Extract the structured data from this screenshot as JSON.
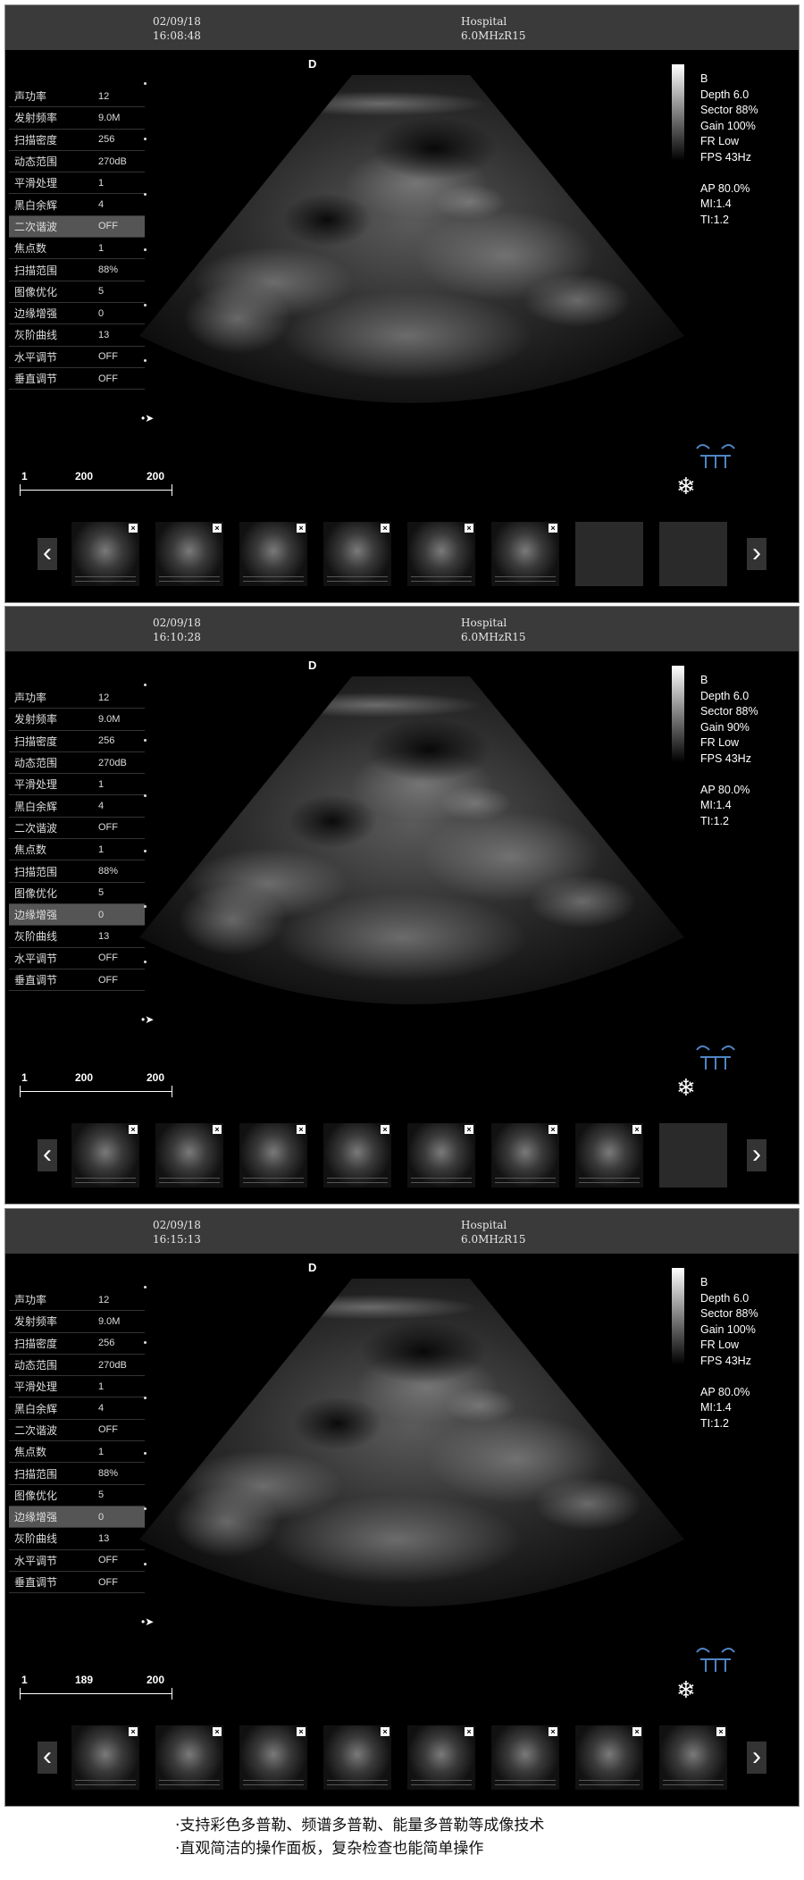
{
  "colors": {
    "background": "#000000",
    "header": "#3a3a3a",
    "probe_icon": "#4f84c4",
    "active_row": "#555555"
  },
  "panels": [
    {
      "date": "02/09/18",
      "time": "16:08:48",
      "hospital": "Hospital",
      "probe": "6.0MHzR15",
      "depth_marker": "D",
      "params": [
        {
          "label": "声功率",
          "value": "12"
        },
        {
          "label": "发射频率",
          "value": "9.0M"
        },
        {
          "label": "扫描密度",
          "value": "256"
        },
        {
          "label": "动态范围",
          "value": "270dB"
        },
        {
          "label": "平滑处理",
          "value": "1"
        },
        {
          "label": "黑白余辉",
          "value": "4"
        },
        {
          "label": "二次谐波",
          "value": "OFF"
        },
        {
          "label": "焦点数",
          "value": "1"
        },
        {
          "label": "扫描范围",
          "value": "88%"
        },
        {
          "label": "图像优化",
          "value": "5"
        },
        {
          "label": "边缘增强",
          "value": "0"
        },
        {
          "label": "灰阶曲线",
          "value": "13"
        },
        {
          "label": "水平调节",
          "value": "OFF"
        },
        {
          "label": "垂直调节",
          "value": "OFF"
        }
      ],
      "active_param": 6,
      "scale": {
        "a": "1",
        "b": "200",
        "c": "200"
      },
      "info": [
        "B",
        "Depth 6.0",
        "Sector 88%",
        "Gain 100%",
        "FR Low",
        "FPS 43Hz",
        "",
        "AP 80.0%",
        "MI:1.4",
        "TI:1.2"
      ],
      "thumb_count": 6
    },
    {
      "date": "02/09/18",
      "time": "16:10:28",
      "hospital": "Hospital",
      "probe": "6.0MHzR15",
      "depth_marker": "D",
      "params": [
        {
          "label": "声功率",
          "value": "12"
        },
        {
          "label": "发射频率",
          "value": "9.0M"
        },
        {
          "label": "扫描密度",
          "value": "256"
        },
        {
          "label": "动态范围",
          "value": "270dB"
        },
        {
          "label": "平滑处理",
          "value": "1"
        },
        {
          "label": "黑白余辉",
          "value": "4"
        },
        {
          "label": "二次谐波",
          "value": "OFF"
        },
        {
          "label": "焦点数",
          "value": "1"
        },
        {
          "label": "扫描范围",
          "value": "88%"
        },
        {
          "label": "图像优化",
          "value": "5"
        },
        {
          "label": "边缘增强",
          "value": "0"
        },
        {
          "label": "灰阶曲线",
          "value": "13"
        },
        {
          "label": "水平调节",
          "value": "OFF"
        },
        {
          "label": "垂直调节",
          "value": "OFF"
        }
      ],
      "active_param": 10,
      "scale": {
        "a": "1",
        "b": "200",
        "c": "200"
      },
      "info": [
        "B",
        "Depth 6.0",
        "Sector 88%",
        "Gain 90%",
        "FR Low",
        "FPS 43Hz",
        "",
        "AP 80.0%",
        "MI:1.4",
        "TI:1.2"
      ],
      "thumb_count": 7
    },
    {
      "date": "02/09/18",
      "time": "16:15:13",
      "hospital": "Hospital",
      "probe": "6.0MHzR15",
      "depth_marker": "D",
      "params": [
        {
          "label": "声功率",
          "value": "12"
        },
        {
          "label": "发射频率",
          "value": "9.0M"
        },
        {
          "label": "扫描密度",
          "value": "256"
        },
        {
          "label": "动态范围",
          "value": "270dB"
        },
        {
          "label": "平滑处理",
          "value": "1"
        },
        {
          "label": "黑白余辉",
          "value": "4"
        },
        {
          "label": "二次谐波",
          "value": "OFF"
        },
        {
          "label": "焦点数",
          "value": "1"
        },
        {
          "label": "扫描范围",
          "value": "88%"
        },
        {
          "label": "图像优化",
          "value": "5"
        },
        {
          "label": "边缘增强",
          "value": "0"
        },
        {
          "label": "灰阶曲线",
          "value": "13"
        },
        {
          "label": "水平调节",
          "value": "OFF"
        },
        {
          "label": "垂直调节",
          "value": "OFF"
        }
      ],
      "active_param": 10,
      "scale": {
        "a": "1",
        "b": "189",
        "c": "200"
      },
      "info": [
        "B",
        "Depth 6.0",
        "Sector 88%",
        "Gain 100%",
        "FR Low",
        "FPS 43Hz",
        "",
        "AP 80.0%",
        "MI:1.4",
        "TI:1.2"
      ],
      "thumb_count": 8
    }
  ],
  "captions": [
    "·支持彩色多普勒、频谱多普勒、能量多普勒等成像技术",
    "·直观简洁的操作面板，复杂检查也能简单操作"
  ]
}
